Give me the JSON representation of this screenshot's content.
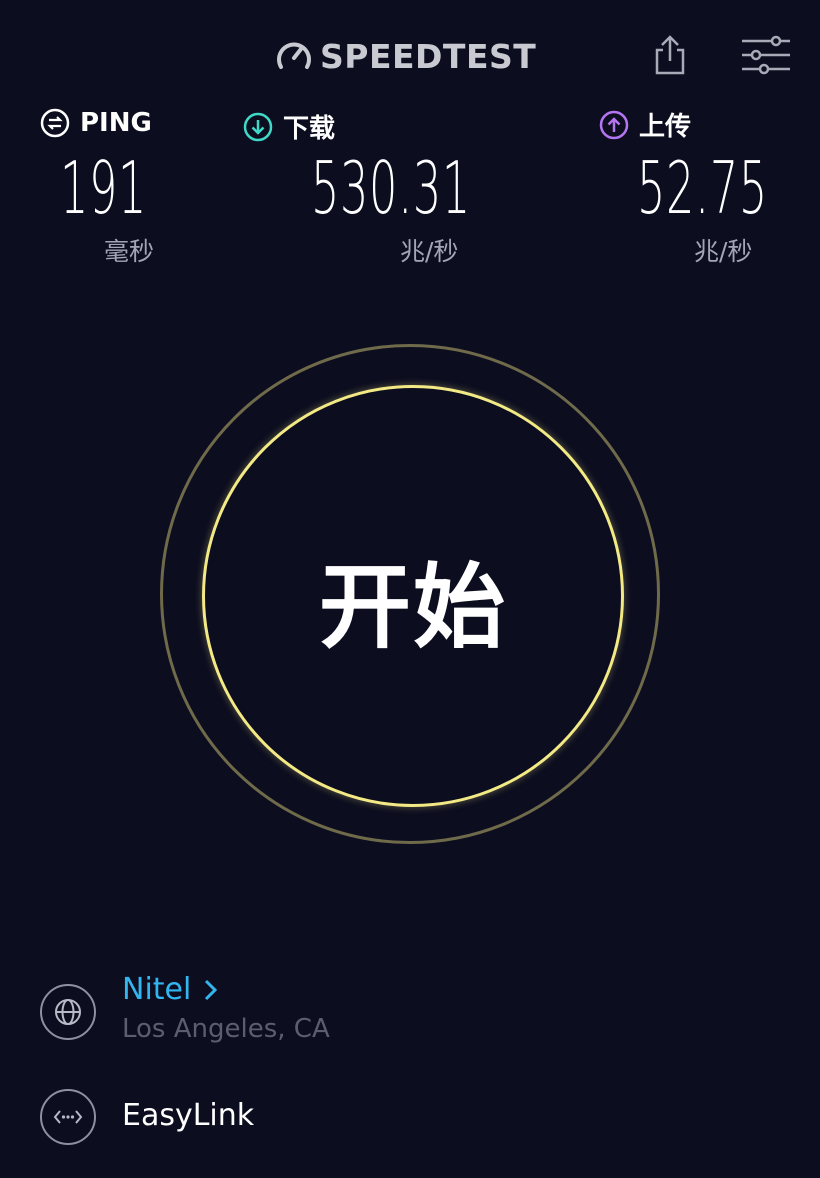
{
  "header": {
    "logo_text": "SPEEDTEST",
    "share_icon": "share-icon",
    "settings_icon": "sliders-icon"
  },
  "metrics": {
    "ping": {
      "label": "PING",
      "value": "191",
      "unit": "毫秒",
      "icon": "ping-icon",
      "color": "#ffffff"
    },
    "download": {
      "label": "下载",
      "value": "530.31",
      "unit": "兆/秒",
      "icon": "download-arrow-icon",
      "color": "#3fd9c8"
    },
    "upload": {
      "label": "上传",
      "value": "52.75",
      "unit": "兆/秒",
      "icon": "upload-arrow-icon",
      "color": "#b475f0"
    }
  },
  "go_button": {
    "label": "开始",
    "ring_color": "#f3ea86",
    "outer_ring_color": "#6f6a4a"
  },
  "provider": {
    "name": "Nitel",
    "location": "Los Angeles, CA",
    "icon": "globe-icon",
    "accent": "#33b6f0"
  },
  "connection": {
    "name": "EasyLink",
    "icon": "connection-dots-icon"
  },
  "colors": {
    "background": "#0c0d1f",
    "muted_text": "#a4a5b4"
  }
}
